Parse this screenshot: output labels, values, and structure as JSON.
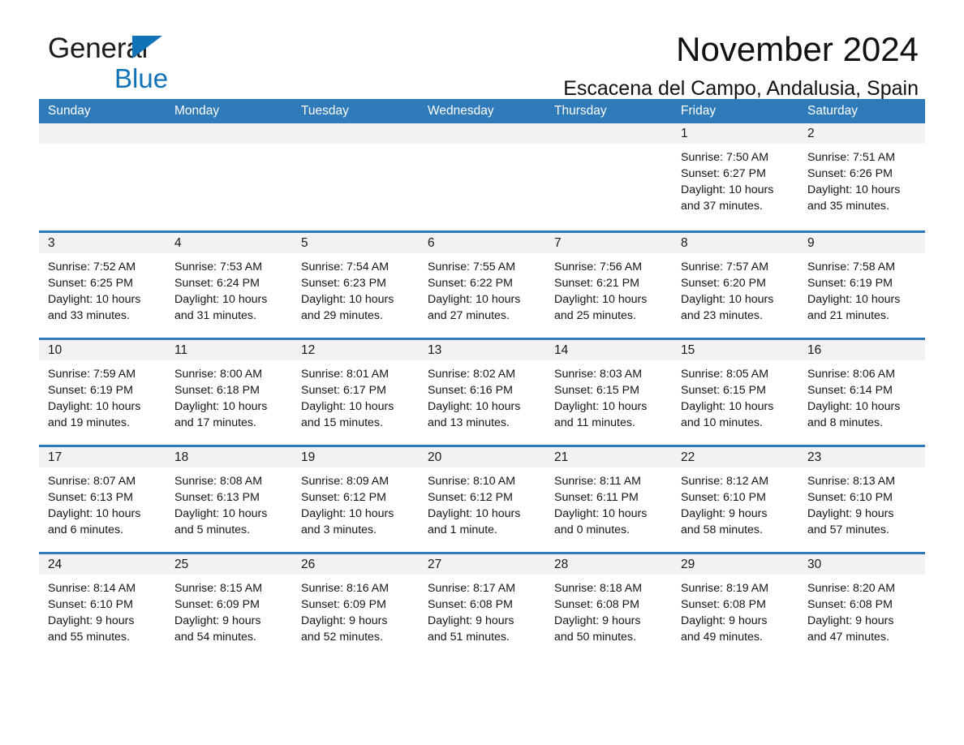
{
  "brand": {
    "word1": "General",
    "word2": "Blue",
    "triangle_color": "#1073b8",
    "accent_color": "#2f7ab8"
  },
  "header": {
    "title": "November 2024",
    "subtitle": "Escacena del Campo, Andalusia, Spain"
  },
  "weekdays": [
    "Sunday",
    "Monday",
    "Tuesday",
    "Wednesday",
    "Thursday",
    "Friday",
    "Saturday"
  ],
  "labels": {
    "sunrise_prefix": "Sunrise:",
    "sunset_prefix": "Sunset:",
    "daylight_prefix": "Daylight:"
  },
  "weeks": [
    [
      {
        "day": "",
        "sunrise": "",
        "sunset": "",
        "daylight_line1": "",
        "daylight_line2": ""
      },
      {
        "day": "",
        "sunrise": "",
        "sunset": "",
        "daylight_line1": "",
        "daylight_line2": ""
      },
      {
        "day": "",
        "sunrise": "",
        "sunset": "",
        "daylight_line1": "",
        "daylight_line2": ""
      },
      {
        "day": "",
        "sunrise": "",
        "sunset": "",
        "daylight_line1": "",
        "daylight_line2": ""
      },
      {
        "day": "",
        "sunrise": "",
        "sunset": "",
        "daylight_line1": "",
        "daylight_line2": ""
      },
      {
        "day": "1",
        "sunrise": "Sunrise: 7:50 AM",
        "sunset": "Sunset: 6:27 PM",
        "daylight_line1": "Daylight: 10 hours",
        "daylight_line2": "and 37 minutes."
      },
      {
        "day": "2",
        "sunrise": "Sunrise: 7:51 AM",
        "sunset": "Sunset: 6:26 PM",
        "daylight_line1": "Daylight: 10 hours",
        "daylight_line2": "and 35 minutes."
      }
    ],
    [
      {
        "day": "3",
        "sunrise": "Sunrise: 7:52 AM",
        "sunset": "Sunset: 6:25 PM",
        "daylight_line1": "Daylight: 10 hours",
        "daylight_line2": "and 33 minutes."
      },
      {
        "day": "4",
        "sunrise": "Sunrise: 7:53 AM",
        "sunset": "Sunset: 6:24 PM",
        "daylight_line1": "Daylight: 10 hours",
        "daylight_line2": "and 31 minutes."
      },
      {
        "day": "5",
        "sunrise": "Sunrise: 7:54 AM",
        "sunset": "Sunset: 6:23 PM",
        "daylight_line1": "Daylight: 10 hours",
        "daylight_line2": "and 29 minutes."
      },
      {
        "day": "6",
        "sunrise": "Sunrise: 7:55 AM",
        "sunset": "Sunset: 6:22 PM",
        "daylight_line1": "Daylight: 10 hours",
        "daylight_line2": "and 27 minutes."
      },
      {
        "day": "7",
        "sunrise": "Sunrise: 7:56 AM",
        "sunset": "Sunset: 6:21 PM",
        "daylight_line1": "Daylight: 10 hours",
        "daylight_line2": "and 25 minutes."
      },
      {
        "day": "8",
        "sunrise": "Sunrise: 7:57 AM",
        "sunset": "Sunset: 6:20 PM",
        "daylight_line1": "Daylight: 10 hours",
        "daylight_line2": "and 23 minutes."
      },
      {
        "day": "9",
        "sunrise": "Sunrise: 7:58 AM",
        "sunset": "Sunset: 6:19 PM",
        "daylight_line1": "Daylight: 10 hours",
        "daylight_line2": "and 21 minutes."
      }
    ],
    [
      {
        "day": "10",
        "sunrise": "Sunrise: 7:59 AM",
        "sunset": "Sunset: 6:19 PM",
        "daylight_line1": "Daylight: 10 hours",
        "daylight_line2": "and 19 minutes."
      },
      {
        "day": "11",
        "sunrise": "Sunrise: 8:00 AM",
        "sunset": "Sunset: 6:18 PM",
        "daylight_line1": "Daylight: 10 hours",
        "daylight_line2": "and 17 minutes."
      },
      {
        "day": "12",
        "sunrise": "Sunrise: 8:01 AM",
        "sunset": "Sunset: 6:17 PM",
        "daylight_line1": "Daylight: 10 hours",
        "daylight_line2": "and 15 minutes."
      },
      {
        "day": "13",
        "sunrise": "Sunrise: 8:02 AM",
        "sunset": "Sunset: 6:16 PM",
        "daylight_line1": "Daylight: 10 hours",
        "daylight_line2": "and 13 minutes."
      },
      {
        "day": "14",
        "sunrise": "Sunrise: 8:03 AM",
        "sunset": "Sunset: 6:15 PM",
        "daylight_line1": "Daylight: 10 hours",
        "daylight_line2": "and 11 minutes."
      },
      {
        "day": "15",
        "sunrise": "Sunrise: 8:05 AM",
        "sunset": "Sunset: 6:15 PM",
        "daylight_line1": "Daylight: 10 hours",
        "daylight_line2": "and 10 minutes."
      },
      {
        "day": "16",
        "sunrise": "Sunrise: 8:06 AM",
        "sunset": "Sunset: 6:14 PM",
        "daylight_line1": "Daylight: 10 hours",
        "daylight_line2": "and 8 minutes."
      }
    ],
    [
      {
        "day": "17",
        "sunrise": "Sunrise: 8:07 AM",
        "sunset": "Sunset: 6:13 PM",
        "daylight_line1": "Daylight: 10 hours",
        "daylight_line2": "and 6 minutes."
      },
      {
        "day": "18",
        "sunrise": "Sunrise: 8:08 AM",
        "sunset": "Sunset: 6:13 PM",
        "daylight_line1": "Daylight: 10 hours",
        "daylight_line2": "and 5 minutes."
      },
      {
        "day": "19",
        "sunrise": "Sunrise: 8:09 AM",
        "sunset": "Sunset: 6:12 PM",
        "daylight_line1": "Daylight: 10 hours",
        "daylight_line2": "and 3 minutes."
      },
      {
        "day": "20",
        "sunrise": "Sunrise: 8:10 AM",
        "sunset": "Sunset: 6:12 PM",
        "daylight_line1": "Daylight: 10 hours",
        "daylight_line2": "and 1 minute."
      },
      {
        "day": "21",
        "sunrise": "Sunrise: 8:11 AM",
        "sunset": "Sunset: 6:11 PM",
        "daylight_line1": "Daylight: 10 hours",
        "daylight_line2": "and 0 minutes."
      },
      {
        "day": "22",
        "sunrise": "Sunrise: 8:12 AM",
        "sunset": "Sunset: 6:10 PM",
        "daylight_line1": "Daylight: 9 hours",
        "daylight_line2": "and 58 minutes."
      },
      {
        "day": "23",
        "sunrise": "Sunrise: 8:13 AM",
        "sunset": "Sunset: 6:10 PM",
        "daylight_line1": "Daylight: 9 hours",
        "daylight_line2": "and 57 minutes."
      }
    ],
    [
      {
        "day": "24",
        "sunrise": "Sunrise: 8:14 AM",
        "sunset": "Sunset: 6:10 PM",
        "daylight_line1": "Daylight: 9 hours",
        "daylight_line2": "and 55 minutes."
      },
      {
        "day": "25",
        "sunrise": "Sunrise: 8:15 AM",
        "sunset": "Sunset: 6:09 PM",
        "daylight_line1": "Daylight: 9 hours",
        "daylight_line2": "and 54 minutes."
      },
      {
        "day": "26",
        "sunrise": "Sunrise: 8:16 AM",
        "sunset": "Sunset: 6:09 PM",
        "daylight_line1": "Daylight: 9 hours",
        "daylight_line2": "and 52 minutes."
      },
      {
        "day": "27",
        "sunrise": "Sunrise: 8:17 AM",
        "sunset": "Sunset: 6:08 PM",
        "daylight_line1": "Daylight: 9 hours",
        "daylight_line2": "and 51 minutes."
      },
      {
        "day": "28",
        "sunrise": "Sunrise: 8:18 AM",
        "sunset": "Sunset: 6:08 PM",
        "daylight_line1": "Daylight: 9 hours",
        "daylight_line2": "and 50 minutes."
      },
      {
        "day": "29",
        "sunrise": "Sunrise: 8:19 AM",
        "sunset": "Sunset: 6:08 PM",
        "daylight_line1": "Daylight: 9 hours",
        "daylight_line2": "and 49 minutes."
      },
      {
        "day": "30",
        "sunrise": "Sunrise: 8:20 AM",
        "sunset": "Sunset: 6:08 PM",
        "daylight_line1": "Daylight: 9 hours",
        "daylight_line2": "and 47 minutes."
      }
    ]
  ]
}
